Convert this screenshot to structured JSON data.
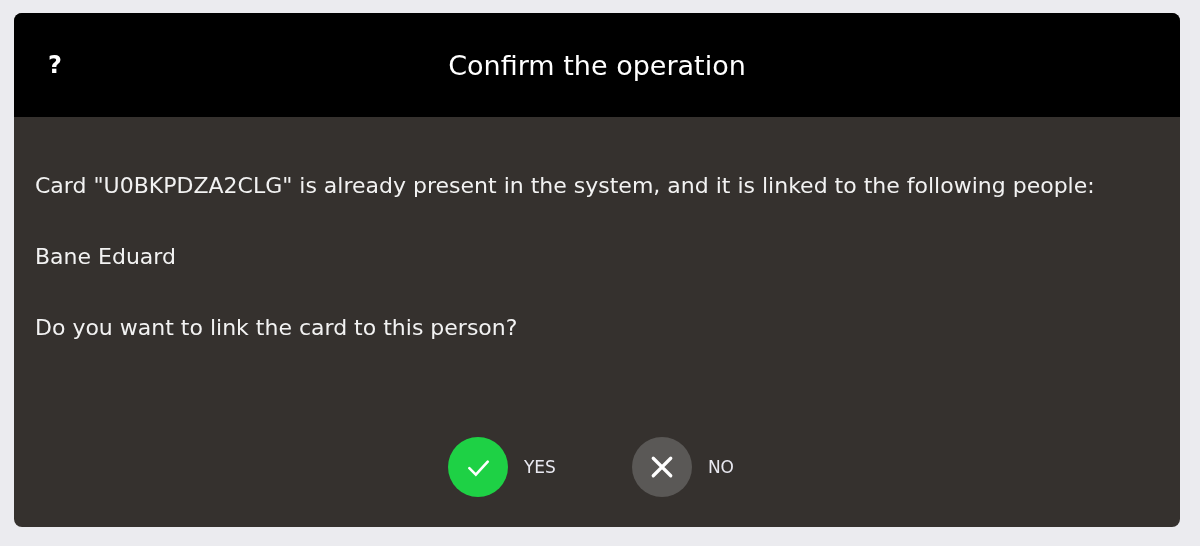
{
  "dialog": {
    "help": "?",
    "title": "Confirm the operation",
    "paragraphs": [
      "Card \"U0BKPDZA2CLG\" is already present in the system, and it is linked to the following people:",
      "Bane Eduard",
      "Do you want to link the card to this person?"
    ],
    "buttons": [
      {
        "kind": "yes",
        "label": "YES"
      },
      {
        "kind": "no",
        "label": "NO"
      }
    ]
  }
}
